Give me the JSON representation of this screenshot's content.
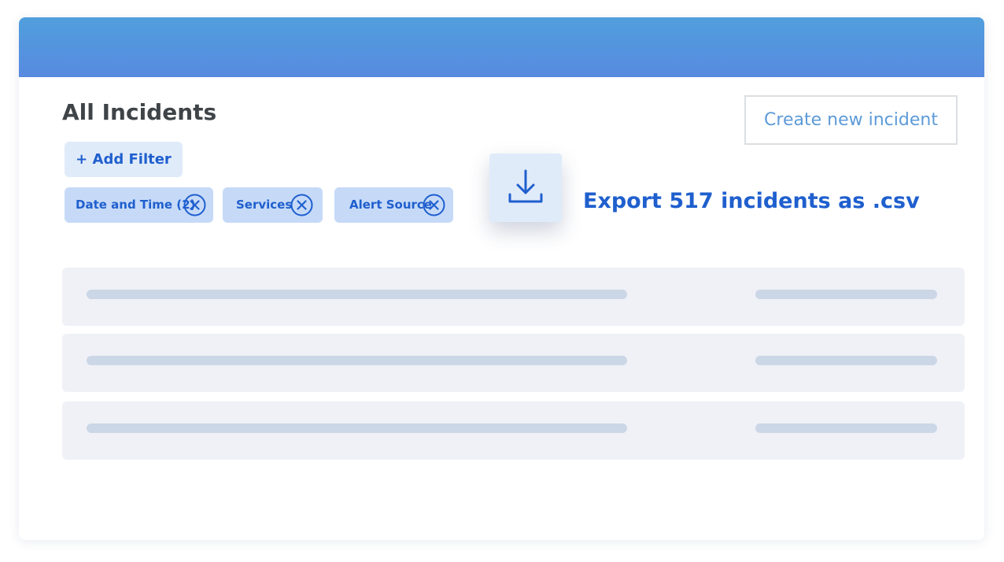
{
  "page": {
    "title": "All Incidents"
  },
  "actions": {
    "create_label": "Create new incident",
    "add_filter_label": "+ Add Filter",
    "export_label": "Export 517 incidents as .csv"
  },
  "filters": [
    {
      "label": "Date and Time (2)",
      "icon": "close-circle-icon"
    },
    {
      "label": "Services",
      "icon": "close-circle-icon"
    },
    {
      "label": "Alert Source",
      "icon": "close-circle-icon"
    }
  ],
  "icons": {
    "export": "download-icon",
    "remove_filter": "close-circle-icon"
  },
  "colors": {
    "header_gradient_start": "#519fdd",
    "header_gradient_end": "#578ae0",
    "accent": "#1f5fce",
    "chip_background": "#c6daf8",
    "button_background": "#e0ebfa",
    "create_text": "#5d9bd8",
    "placeholder_row": "#eff1f6",
    "placeholder_bar": "#cbd6e6"
  }
}
